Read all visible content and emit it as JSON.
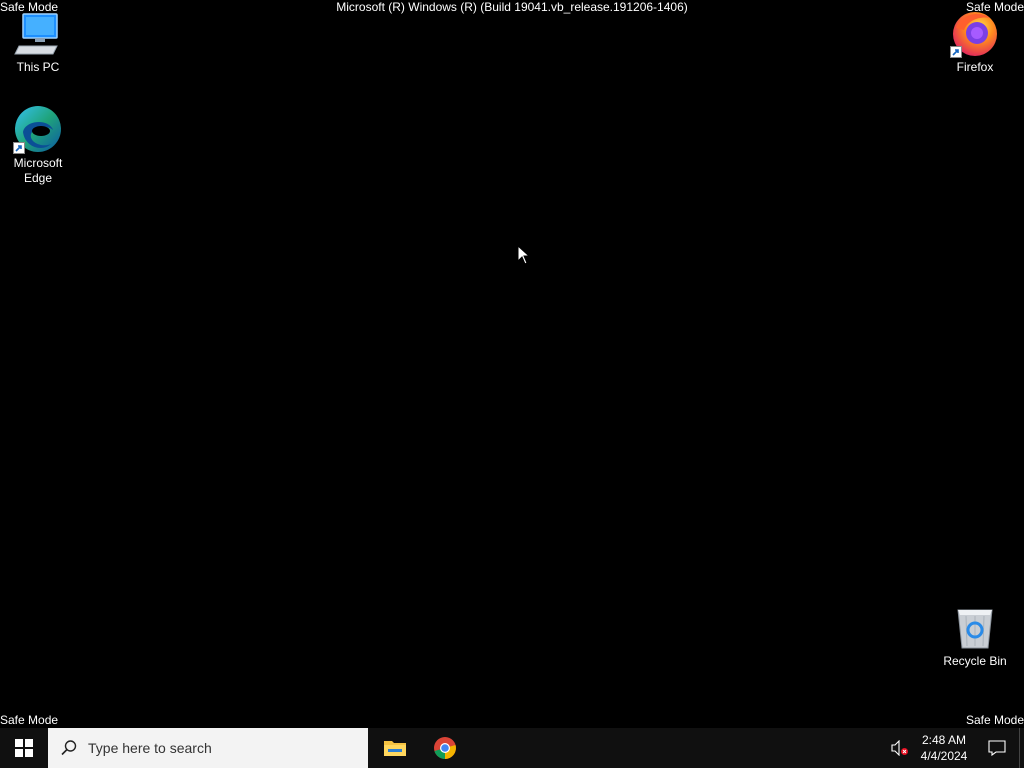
{
  "desktop": {
    "watermark": {
      "top_left": "Safe Mode",
      "top_right": "Safe Mode",
      "bottom_left": "Safe Mode",
      "bottom_right": "Safe Mode",
      "build": "Microsoft (R) Windows (R) (Build 19041.vb_release.191206-1406)"
    },
    "icons": {
      "this_pc": "This PC",
      "edge_line1": "Microsoft",
      "edge_line2": "Edge",
      "firefox": "Firefox",
      "recycle_bin": "Recycle Bin"
    }
  },
  "taskbar": {
    "search_placeholder": "Type here to search",
    "pinned": [
      "file-explorer-icon",
      "chrome-icon"
    ],
    "clock": {
      "time": "2:48 AM",
      "date": "4/4/2024"
    },
    "volume_state": "muted"
  },
  "colors": {
    "desktop_bg": "#000000",
    "taskbar_bg": "#101010",
    "search_bg": "#f3f3f3"
  }
}
